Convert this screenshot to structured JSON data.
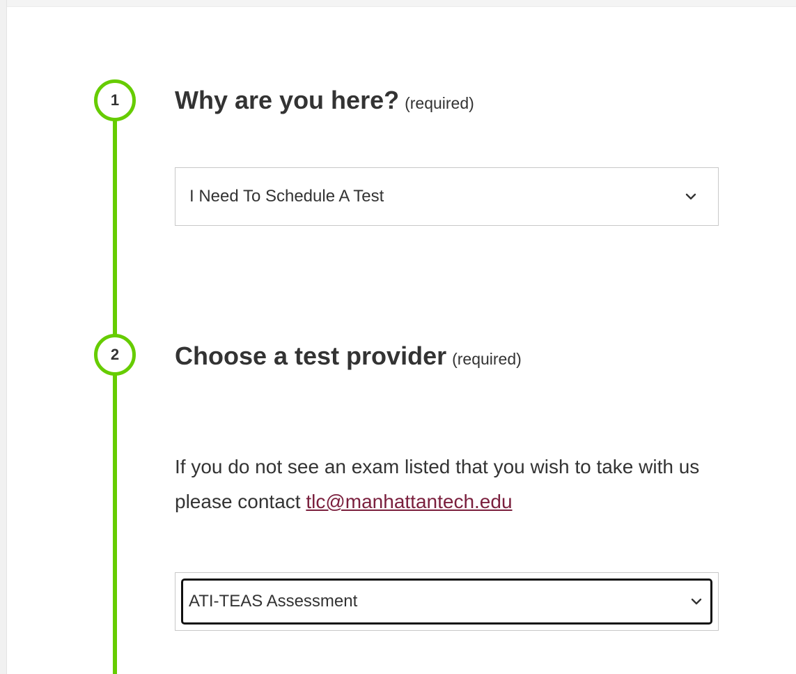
{
  "steps": [
    {
      "number": "1",
      "title": "Why are you here?",
      "required": "(required)",
      "select_value": "I Need To Schedule A Test"
    },
    {
      "number": "2",
      "title": "Choose a test provider",
      "required": "(required)",
      "info_text": "If you do not see an exam listed that you wish to take with us please contact",
      "contact_email": "tlc@manhattantech.edu",
      "select_value": "ATI-TEAS Assessment"
    }
  ],
  "colors": {
    "accent": "#66cc00",
    "link": "#7a1f3d",
    "text": "#333333"
  },
  "icons": {
    "dropdown": "chevron-down-icon"
  }
}
